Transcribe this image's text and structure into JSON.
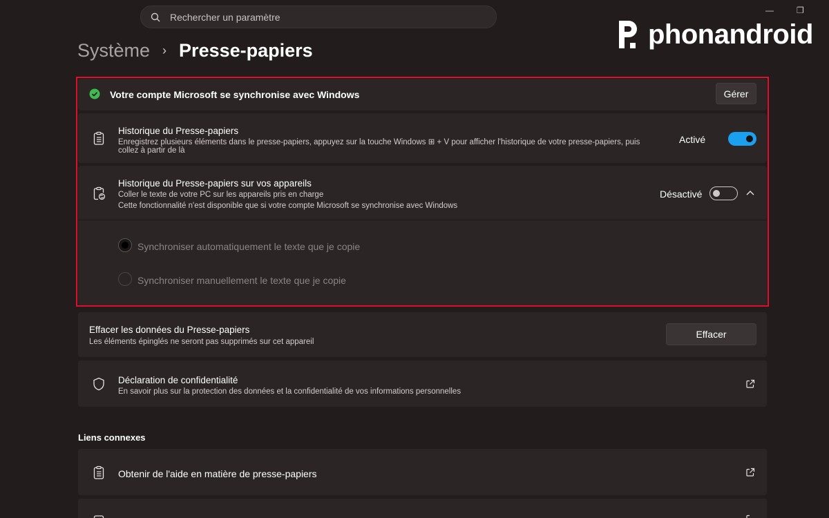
{
  "search": {
    "placeholder": "Rechercher un paramètre"
  },
  "window": {
    "minimize": "—",
    "restore": "❐"
  },
  "logo": {
    "text": "phonandroid"
  },
  "breadcrumb": {
    "parent": "Système",
    "separator": "›",
    "current": "Presse-papiers"
  },
  "sync_banner": {
    "text": "Votre compte Microsoft se synchronise avec Windows",
    "button": "Gérer",
    "status_color": "#3fb950"
  },
  "history": {
    "title": "Historique du Presse-papiers",
    "desc_line1": "Enregistrez plusieurs éléments dans le presse-papiers, appuyez sur la touche Windows ⊞ + V pour afficher l'historique de votre presse-papiers, puis",
    "desc_line2": "collez à partir de là",
    "state": "Activé",
    "enabled": true
  },
  "devices": {
    "title": "Historique du Presse-papiers sur vos appareils",
    "desc_line1": "Coller le texte de votre PC sur les appareils pris en charge",
    "desc_line2": "Cette fonctionnalité n'est disponible que si votre compte Microsoft se synchronise avec Windows",
    "state": "Désactivé",
    "enabled": false,
    "options": [
      {
        "label": "Synchroniser automatiquement le texte que je copie",
        "selected": true
      },
      {
        "label": "Synchroniser manuellement le texte que je copie",
        "selected": false
      }
    ]
  },
  "clear": {
    "title": "Effacer les données du Presse-papiers",
    "desc": "Les éléments épinglés ne seront pas supprimés sur cet appareil",
    "button": "Effacer"
  },
  "privacy": {
    "title": "Déclaration de confidentialité",
    "desc": "En savoir plus sur la protection des données et la confidentialité de vos informations personnelles"
  },
  "related": {
    "heading": "Liens connexes",
    "items": [
      {
        "label": "Obtenir de l'aide en matière de presse-papiers"
      }
    ]
  },
  "colors": {
    "accent": "#1aa0ef",
    "highlight": "#e0102a",
    "background": "#221d1c",
    "card": "#2b2625"
  }
}
